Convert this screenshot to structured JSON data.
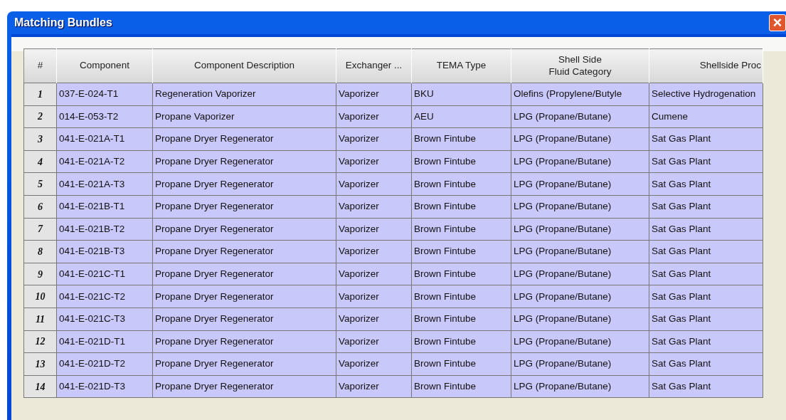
{
  "window": {
    "title": "Matching Bundles",
    "close": "×"
  },
  "table": {
    "columns": [
      "#",
      "Component",
      "Component Description",
      "Exchanger ...",
      "TEMA Type",
      "Shell Side\nFluid Category",
      "Shellside Proc"
    ],
    "rows": [
      {
        "cells": [
          "1",
          "037-E-024-T1",
          "Regeneration Vaporizer",
          "Vaporizer",
          "BKU",
          "Olefins (Propylene/Butyle",
          "Selective Hydrogenation"
        ]
      },
      {
        "cells": [
          "2",
          "014-E-053-T2",
          "Propane Vaporizer",
          "Vaporizer",
          "AEU",
          "LPG (Propane/Butane)",
          "Cumene"
        ]
      },
      {
        "cells": [
          "3",
          "041-E-021A-T1",
          "Propane Dryer Regenerator",
          "Vaporizer",
          "Brown Fintube",
          "LPG (Propane/Butane)",
          "Sat Gas Plant"
        ]
      },
      {
        "cells": [
          "4",
          "041-E-021A-T2",
          "Propane Dryer Regenerator",
          "Vaporizer",
          "Brown Fintube",
          "LPG (Propane/Butane)",
          "Sat Gas Plant"
        ]
      },
      {
        "cells": [
          "5",
          "041-E-021A-T3",
          "Propane Dryer Regenerator",
          "Vaporizer",
          "Brown Fintube",
          "LPG (Propane/Butane)",
          "Sat Gas Plant"
        ]
      },
      {
        "cells": [
          "6",
          "041-E-021B-T1",
          "Propane Dryer Regenerator",
          "Vaporizer",
          "Brown Fintube",
          "LPG (Propane/Butane)",
          "Sat Gas Plant"
        ]
      },
      {
        "cells": [
          "7",
          "041-E-021B-T2",
          "Propane Dryer Regenerator",
          "Vaporizer",
          "Brown Fintube",
          "LPG (Propane/Butane)",
          "Sat Gas Plant"
        ]
      },
      {
        "cells": [
          "8",
          "041-E-021B-T3",
          "Propane Dryer Regenerator",
          "Vaporizer",
          "Brown Fintube",
          "LPG (Propane/Butane)",
          "Sat Gas Plant"
        ]
      },
      {
        "cells": [
          "9",
          "041-E-021C-T1",
          "Propane Dryer Regenerator",
          "Vaporizer",
          "Brown Fintube",
          "LPG (Propane/Butane)",
          "Sat Gas Plant"
        ]
      },
      {
        "cells": [
          "10",
          "041-E-021C-T2",
          "Propane Dryer Regenerator",
          "Vaporizer",
          "Brown Fintube",
          "LPG (Propane/Butane)",
          "Sat Gas Plant"
        ]
      },
      {
        "cells": [
          "11",
          "041-E-021C-T3",
          "Propane Dryer Regenerator",
          "Vaporizer",
          "Brown Fintube",
          "LPG (Propane/Butane)",
          "Sat Gas Plant"
        ]
      },
      {
        "cells": [
          "12",
          "041-E-021D-T1",
          "Propane Dryer Regenerator",
          "Vaporizer",
          "Brown Fintube",
          "LPG (Propane/Butane)",
          "Sat Gas Plant"
        ]
      },
      {
        "cells": [
          "13",
          "041-E-021D-T2",
          "Propane Dryer Regenerator",
          "Vaporizer",
          "Brown Fintube",
          "LPG (Propane/Butane)",
          "Sat Gas Plant"
        ]
      },
      {
        "cells": [
          "14",
          "041-E-021D-T3",
          "Propane Dryer Regenerator",
          "Vaporizer",
          "Brown Fintube",
          "LPG (Propane/Butane)",
          "Sat Gas Plant"
        ]
      }
    ]
  }
}
